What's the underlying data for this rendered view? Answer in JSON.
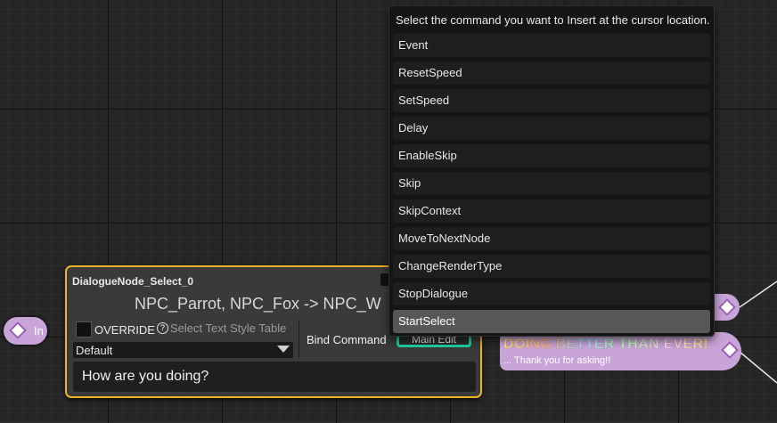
{
  "graph": {
    "input_pin_label": "In"
  },
  "node": {
    "title": "DialogueNode_Select_0",
    "speakers": "NPC_Parrot, NPC_Fox -> NPC_W",
    "override_label": "OVERRIDE",
    "style_table_placeholder": "Select Text Style Table",
    "style_dropdown_value": "Default",
    "bind_command_label": "Bind Command",
    "main_edit_label": "Main Edit",
    "dialogue_text": "How are you doing?"
  },
  "response": {
    "title": "DOING BETTER THAN EVER!",
    "subtitle": "... Thank you for asking!!"
  },
  "command_popup": {
    "header": "Select the command you want to Insert at the cursor location.",
    "items": [
      {
        "label": "Event"
      },
      {
        "label": "ResetSpeed"
      },
      {
        "label": "SetSpeed"
      },
      {
        "label": "Delay"
      },
      {
        "label": "EnableSkip"
      },
      {
        "label": "Skip"
      },
      {
        "label": "SkipContext"
      },
      {
        "label": "MoveToNextNode"
      },
      {
        "label": "ChangeRenderType"
      },
      {
        "label": "StopDialogue"
      },
      {
        "label": "StartSelect"
      }
    ],
    "selected": "StartSelect"
  },
  "colors": {
    "node_border": "#f0b323",
    "pin_color": "#c9a4d8",
    "main_edit_border": "#1fd0a4",
    "selected_item": "#575757"
  }
}
